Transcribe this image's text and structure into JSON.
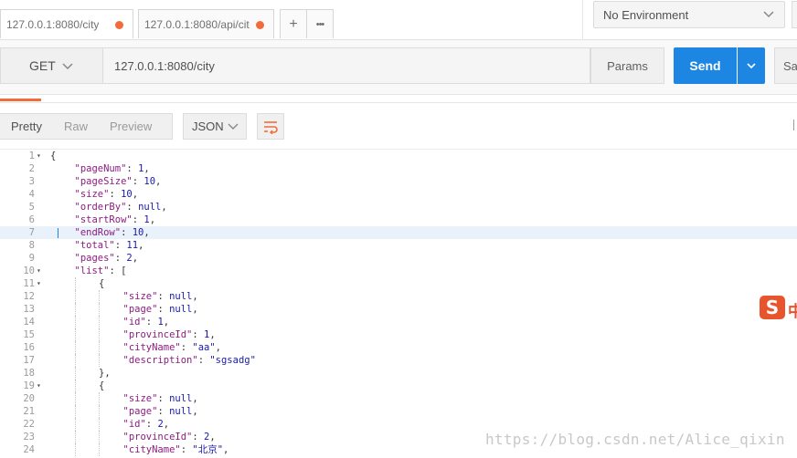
{
  "tabs": [
    {
      "label": "127.0.0.1:8080/city",
      "unsaved": true
    },
    {
      "label": "127.0.0.1:8080/api/cit",
      "unsaved": true
    }
  ],
  "tab_actions": {
    "new": "+",
    "more": "•••"
  },
  "environment": {
    "selected": "No Environment"
  },
  "request": {
    "method": "GET",
    "url": "127.0.0.1:8080/city",
    "params_label": "Params",
    "send_label": "Send",
    "save_label": "Sa"
  },
  "response": {
    "view_modes": [
      "Pretty",
      "Raw",
      "Preview"
    ],
    "active_view_mode": "Pretty",
    "format": "JSON",
    "highlighted_line": 7,
    "code_lines": [
      {
        "n": 1,
        "fold": true,
        "indent": 0,
        "text": "{"
      },
      {
        "n": 2,
        "fold": false,
        "indent": 1,
        "key": "pageNum",
        "value": "1",
        "vtype": "num",
        "comma": true
      },
      {
        "n": 3,
        "fold": false,
        "indent": 1,
        "key": "pageSize",
        "value": "10",
        "vtype": "num",
        "comma": true
      },
      {
        "n": 4,
        "fold": false,
        "indent": 1,
        "key": "size",
        "value": "10",
        "vtype": "num",
        "comma": true
      },
      {
        "n": 5,
        "fold": false,
        "indent": 1,
        "key": "orderBy",
        "value": "null",
        "vtype": "nul",
        "comma": true
      },
      {
        "n": 6,
        "fold": false,
        "indent": 1,
        "key": "startRow",
        "value": "1",
        "vtype": "num",
        "comma": true
      },
      {
        "n": 7,
        "fold": false,
        "indent": 1,
        "key": "endRow",
        "value": "10",
        "vtype": "num",
        "comma": true
      },
      {
        "n": 8,
        "fold": false,
        "indent": 1,
        "key": "total",
        "value": "11",
        "vtype": "num",
        "comma": true
      },
      {
        "n": 9,
        "fold": false,
        "indent": 1,
        "key": "pages",
        "value": "2",
        "vtype": "num",
        "comma": true
      },
      {
        "n": 10,
        "fold": true,
        "indent": 1,
        "key": "list",
        "value": "[",
        "vtype": "punc",
        "comma": false
      },
      {
        "n": 11,
        "fold": true,
        "indent": 2,
        "text": "{"
      },
      {
        "n": 12,
        "fold": false,
        "indent": 3,
        "key": "size",
        "value": "null",
        "vtype": "nul",
        "comma": true
      },
      {
        "n": 13,
        "fold": false,
        "indent": 3,
        "key": "page",
        "value": "null",
        "vtype": "nul",
        "comma": true
      },
      {
        "n": 14,
        "fold": false,
        "indent": 3,
        "key": "id",
        "value": "1",
        "vtype": "num",
        "comma": true
      },
      {
        "n": 15,
        "fold": false,
        "indent": 3,
        "key": "provinceId",
        "value": "1",
        "vtype": "num",
        "comma": true
      },
      {
        "n": 16,
        "fold": false,
        "indent": 3,
        "key": "cityName",
        "value": "\"aa\"",
        "vtype": "str",
        "comma": true
      },
      {
        "n": 17,
        "fold": false,
        "indent": 3,
        "key": "description",
        "value": "\"sgsadg\"",
        "vtype": "str",
        "comma": false
      },
      {
        "n": 18,
        "fold": false,
        "indent": 2,
        "text": "},"
      },
      {
        "n": 19,
        "fold": true,
        "indent": 2,
        "text": "{"
      },
      {
        "n": 20,
        "fold": false,
        "indent": 3,
        "key": "size",
        "value": "null",
        "vtype": "nul",
        "comma": true
      },
      {
        "n": 21,
        "fold": false,
        "indent": 3,
        "key": "page",
        "value": "null",
        "vtype": "nul",
        "comma": true
      },
      {
        "n": 22,
        "fold": false,
        "indent": 3,
        "key": "id",
        "value": "2",
        "vtype": "num",
        "comma": true
      },
      {
        "n": 23,
        "fold": false,
        "indent": 3,
        "key": "provinceId",
        "value": "2",
        "vtype": "num",
        "comma": true
      },
      {
        "n": 24,
        "fold": false,
        "indent": 3,
        "key": "cityName",
        "value": "\"北京\"",
        "vtype": "str",
        "comma": true
      }
    ]
  },
  "ime": {
    "logo": "S",
    "mode": "中"
  },
  "watermark": "https://blog.csdn.net/Alice_qixin",
  "colors": {
    "accent": "#f26b3a",
    "send": "#1d86e3",
    "key": "#8a1e7e",
    "value": "#1a1aa6"
  }
}
